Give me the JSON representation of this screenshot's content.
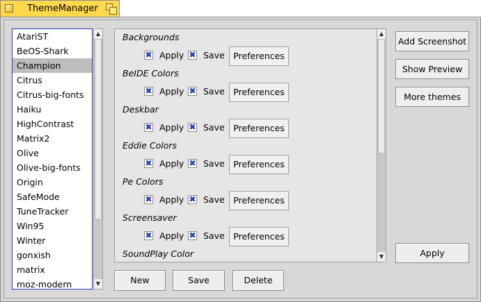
{
  "window": {
    "title": "ThemeManager"
  },
  "themes": [
    "AtariST",
    "BeOS-Shark",
    "Champion",
    "Citrus",
    "Citrus-big-fonts",
    "Haiku",
    "HighContrast",
    "Matrix2",
    "Olive",
    "Olive-big-fonts",
    "Origin",
    "SafeMode",
    "TuneTracker",
    "Win95",
    "Winter",
    "gonxish",
    "matrix",
    "moz-modern"
  ],
  "selected_theme": "Champion",
  "addons": [
    {
      "name": "Backgrounds",
      "apply_label": "Apply",
      "save_label": "Save",
      "pref_label": "Preferences",
      "apply": true,
      "save": true
    },
    {
      "name": "BeIDE Colors",
      "apply_label": "Apply",
      "save_label": "Save",
      "pref_label": "Preferences",
      "apply": true,
      "save": true
    },
    {
      "name": "Deskbar",
      "apply_label": "Apply",
      "save_label": "Save",
      "pref_label": "Preferences",
      "apply": true,
      "save": true
    },
    {
      "name": "Eddie Colors",
      "apply_label": "Apply",
      "save_label": "Save",
      "pref_label": "Preferences",
      "apply": true,
      "save": true
    },
    {
      "name": "Pe Colors",
      "apply_label": "Apply",
      "save_label": "Save",
      "pref_label": "Preferences",
      "apply": true,
      "save": true
    },
    {
      "name": "Screensaver",
      "apply_label": "Apply",
      "save_label": "Save",
      "pref_label": "Preferences",
      "apply": true,
      "save": true
    },
    {
      "name": "SoundPlay Color"
    }
  ],
  "buttons": {
    "add_screenshot": "Add Screenshot",
    "show_preview": "Show Preview",
    "more_themes": "More themes",
    "apply": "Apply",
    "new": "New",
    "save": "Save",
    "delete": "Delete"
  },
  "icons": {
    "check": "✖",
    "arrow_up": "▲",
    "arrow_down": "▼"
  }
}
